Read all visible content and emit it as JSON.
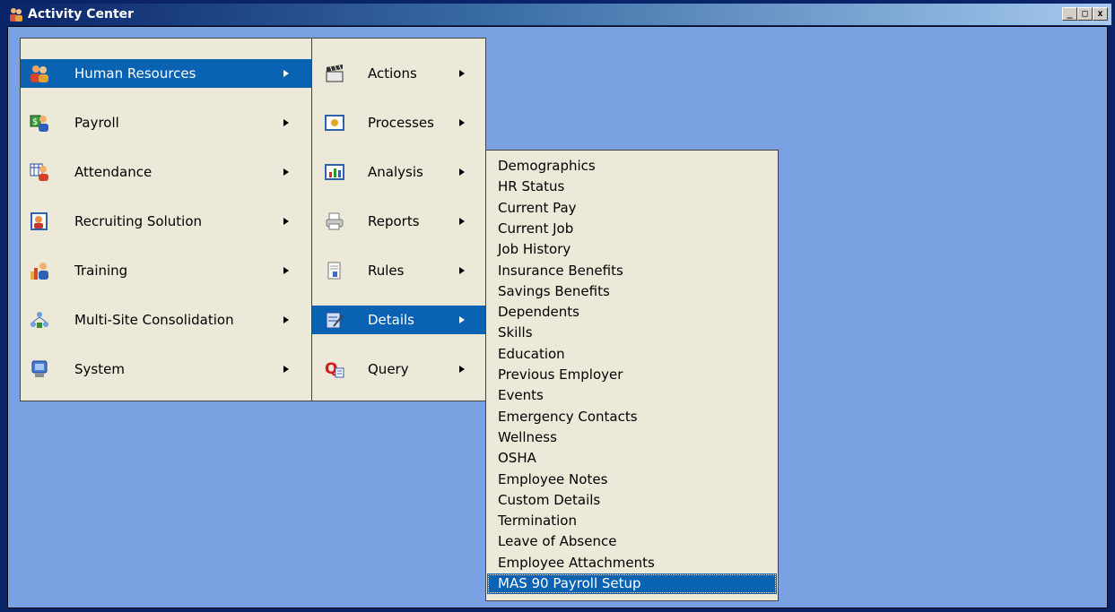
{
  "window": {
    "title": "Activity Center",
    "controls": [
      "_",
      "□",
      "x"
    ]
  },
  "main_menu": {
    "items": [
      {
        "label": "Human Resources",
        "icon": "hr-people-icon",
        "selected": true
      },
      {
        "label": "Payroll",
        "icon": "payroll-icon",
        "selected": false
      },
      {
        "label": "Attendance",
        "icon": "attendance-icon",
        "selected": false
      },
      {
        "label": "Recruiting Solution",
        "icon": "recruiting-icon",
        "selected": false
      },
      {
        "label": "Training",
        "icon": "training-icon",
        "selected": false
      },
      {
        "label": "Multi-Site Consolidation",
        "icon": "multisite-icon",
        "selected": false
      },
      {
        "label": "System",
        "icon": "system-icon",
        "selected": false
      }
    ]
  },
  "hr_submenu": {
    "items": [
      {
        "label": "Actions",
        "icon": "clapper-icon",
        "selected": false
      },
      {
        "label": "Processes",
        "icon": "processes-icon",
        "selected": false
      },
      {
        "label": "Analysis",
        "icon": "chart-icon",
        "selected": false
      },
      {
        "label": "Reports",
        "icon": "printer-icon",
        "selected": false
      },
      {
        "label": "Rules",
        "icon": "rules-icon",
        "selected": false
      },
      {
        "label": "Details",
        "icon": "details-icon",
        "selected": true
      },
      {
        "label": "Query",
        "icon": "query-icon",
        "selected": false
      }
    ]
  },
  "details_list": {
    "items": [
      "Demographics",
      "HR Status",
      "Current Pay",
      "Current Job",
      "Job History",
      "Insurance Benefits",
      "Savings Benefits",
      "Dependents",
      "Skills",
      "Education",
      "Previous Employer",
      "Events",
      "Emergency Contacts",
      "Wellness",
      "OSHA",
      "Employee Notes",
      "Custom Details",
      "Termination",
      "Leave of Absence",
      "Employee Attachments",
      "MAS 90 Payroll Setup"
    ],
    "selected_index": 20
  },
  "colors": {
    "desktop": "#7aa1e2",
    "menu_bg": "#ece9d8",
    "highlight": "#0a62b2"
  }
}
